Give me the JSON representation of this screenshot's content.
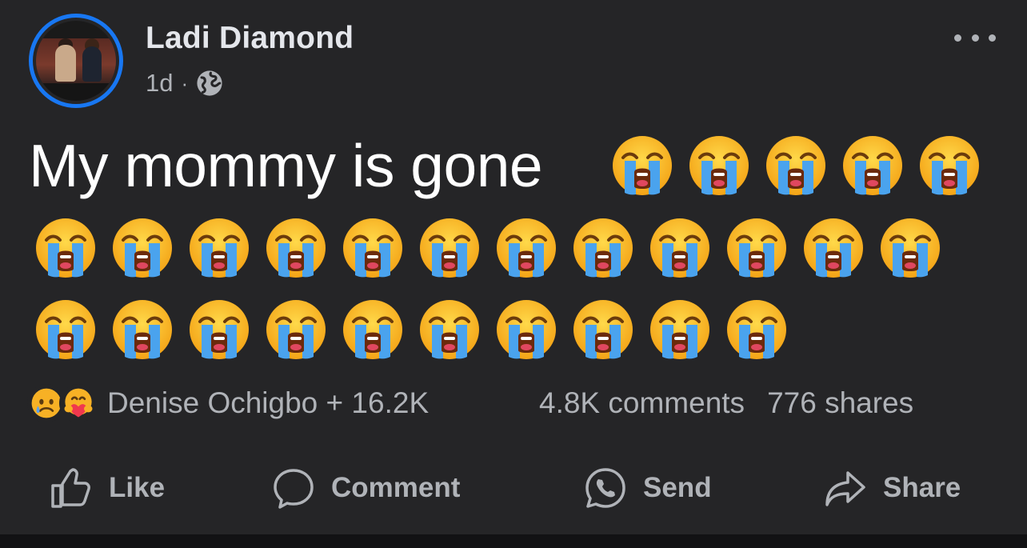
{
  "post": {
    "author": "Ladi Diamond",
    "time": "1d",
    "separator": "·",
    "audience_icon": "globe-icon",
    "more_icon": "more-options-icon",
    "message_text": "My mommy is gone",
    "emoji": "loudly-crying-face",
    "emoji_count": 27,
    "accent_color": "#1877f2"
  },
  "reactions": {
    "icons": [
      "sad-reaction-icon",
      "care-reaction-icon"
    ],
    "summary": "Denise Ochigbo + 16.2K",
    "comments": "4.8K comments",
    "shares": "776 shares"
  },
  "actions": {
    "like": "Like",
    "comment": "Comment",
    "send": "Send",
    "share": "Share"
  }
}
